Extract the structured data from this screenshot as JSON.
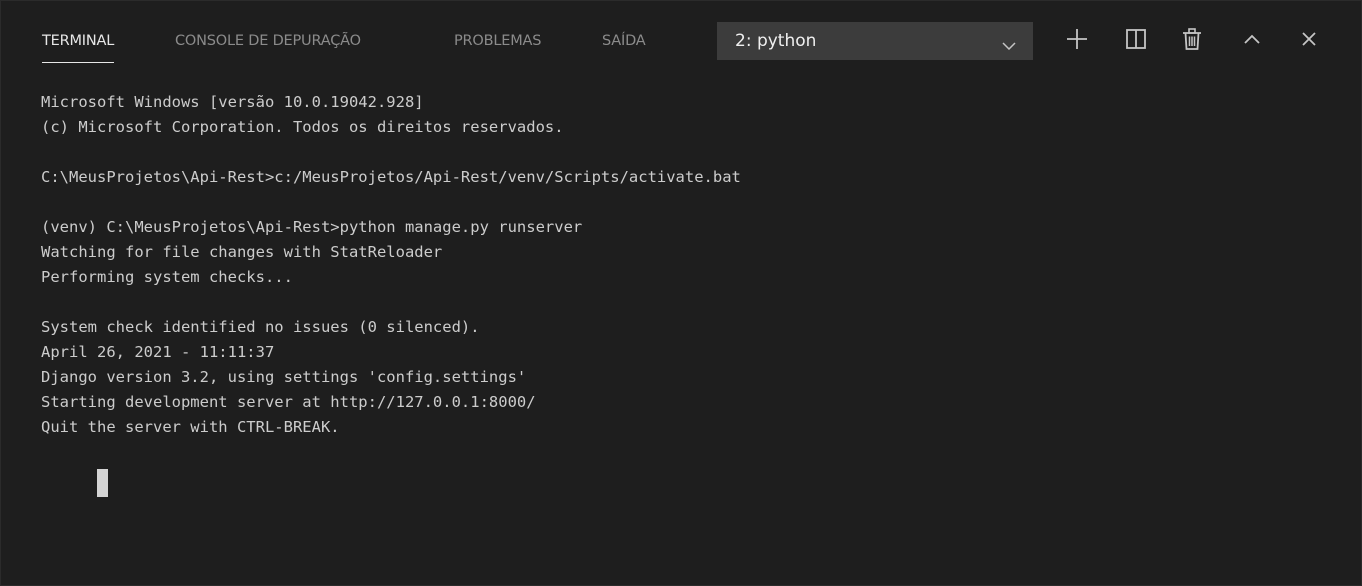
{
  "tabs": [
    {
      "label": "TERMINAL",
      "active": true
    },
    {
      "label": "CONSOLE DE DEPURAÇÃO",
      "active": false
    },
    {
      "label": "PROBLEMAS",
      "active": false
    },
    {
      "label": "SAÍDA",
      "active": false
    }
  ],
  "terminal_select": {
    "value": "2: python"
  },
  "toolbar_icons": [
    "plus-icon",
    "split-icon",
    "trash-icon",
    "chevron-up-icon",
    "close-icon"
  ],
  "colors": {
    "background": "#1e1e1e",
    "text": "#cccccc",
    "active_tab": "#e7e7e7",
    "inactive_tab": "#8b8b8b",
    "dropdown_bg": "#3c3c3c"
  },
  "terminal": {
    "lines": [
      "Microsoft Windows [versão 10.0.19042.928]",
      "(c) Microsoft Corporation. Todos os direitos reservados.",
      "",
      "C:\\MeusProjetos\\Api-Rest>c:/MeusProjetos/Api-Rest/venv/Scripts/activate.bat",
      "",
      "(venv) C:\\MeusProjetos\\Api-Rest>python manage.py runserver",
      "Watching for file changes with StatReloader",
      "Performing system checks...",
      "",
      "System check identified no issues (0 silenced).",
      "April 26, 2021 - 11:11:37",
      "Django version 3.2, using settings 'config.settings'",
      "Starting development server at http://127.0.0.1:8000/",
      "Quit the server with CTRL-BREAK."
    ]
  }
}
